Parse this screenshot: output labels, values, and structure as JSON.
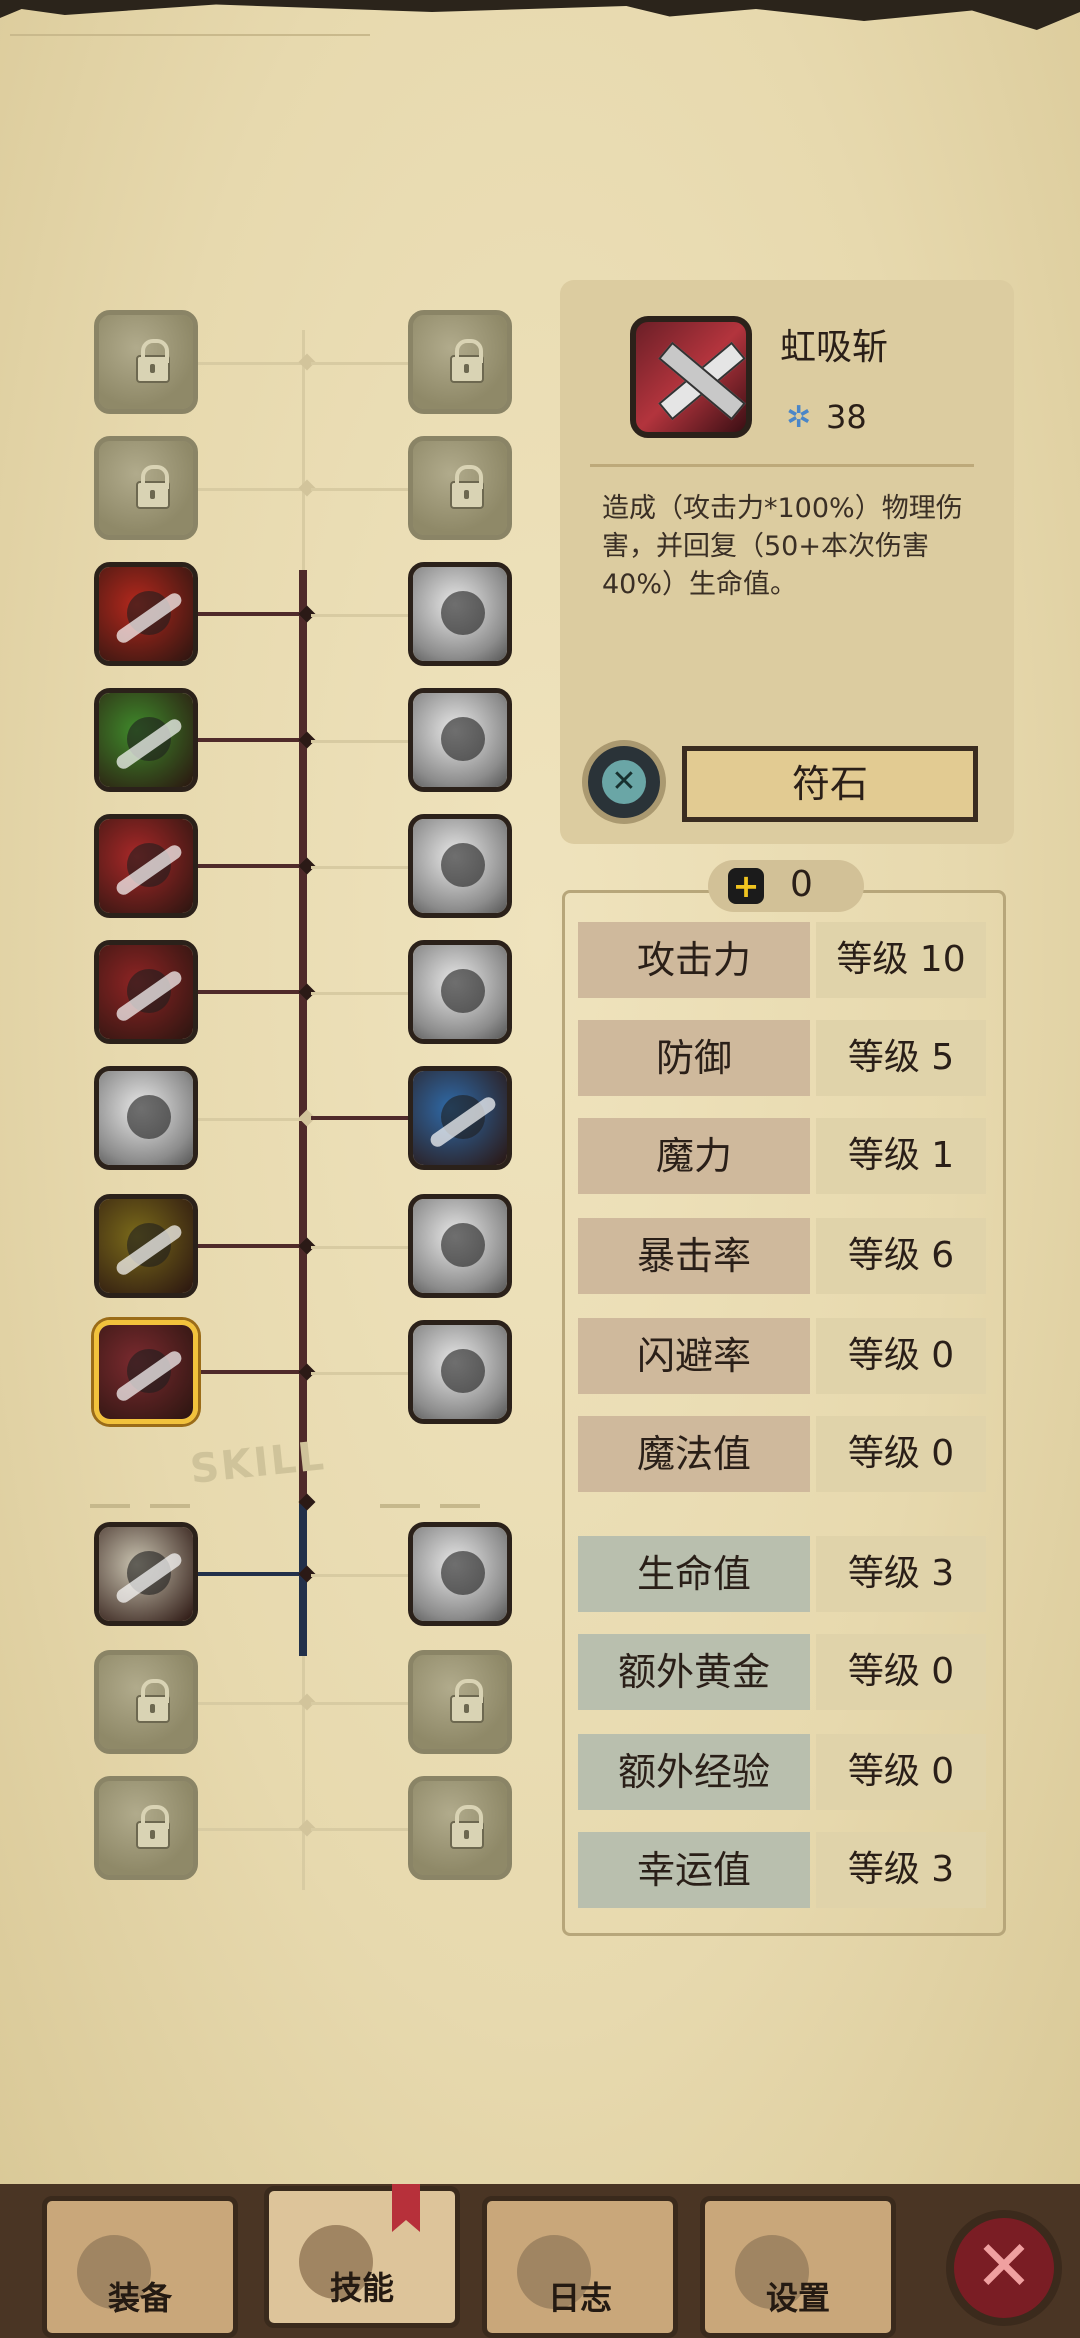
{
  "skill_tree": {
    "divider_label": "SKILL",
    "left_column": [
      {
        "state": "locked",
        "icon": "lock-icon"
      },
      {
        "state": "locked",
        "icon": "lock-icon"
      },
      {
        "state": "learned",
        "icon": "rage-face-icon",
        "color": "#b4281d"
      },
      {
        "state": "learned",
        "icon": "flex-arm-icon",
        "color": "#3f8a2b"
      },
      {
        "state": "learned",
        "icon": "shadow-slash-icon",
        "color": "#a82828"
      },
      {
        "state": "learned",
        "icon": "dagger-icon",
        "color": "#8e2424"
      },
      {
        "state": "unlearned",
        "icon": "falling-figure-icon"
      },
      {
        "state": "learned",
        "icon": "lightning-warrior-icon",
        "color": "#7a6a1a"
      },
      {
        "state": "selected",
        "icon": "crossed-swords-icon",
        "color": "#7b2a2f"
      },
      {
        "state": "learned",
        "icon": "shield-arrow-icon",
        "color": "#c9c3b0"
      },
      {
        "state": "locked",
        "icon": "lock-icon"
      },
      {
        "state": "locked",
        "icon": "lock-icon"
      }
    ],
    "right_column": [
      {
        "state": "locked",
        "icon": "lock-icon"
      },
      {
        "state": "locked",
        "icon": "lock-icon"
      },
      {
        "state": "unlearned",
        "icon": "lightning-strike-icon"
      },
      {
        "state": "unlearned",
        "icon": "dash-figure-icon"
      },
      {
        "state": "unlearned",
        "icon": "smoke-figure-icon"
      },
      {
        "state": "unlearned",
        "icon": "rock-icon"
      },
      {
        "state": "learned",
        "icon": "wind-blade-icon",
        "color": "#2f6aa8"
      },
      {
        "state": "unlearned",
        "icon": "explosion-icon"
      },
      {
        "state": "unlearned",
        "icon": "sparkle-figure-icon"
      },
      {
        "state": "unlearned",
        "icon": "eye-icon"
      },
      {
        "state": "locked",
        "icon": "lock-icon"
      },
      {
        "state": "locked",
        "icon": "lock-icon"
      }
    ]
  },
  "detail": {
    "skill_name": "虹吸斩",
    "cost": "38",
    "description": "造成（攻击力*100%）物理伤害，并回复（50+本次伤害40%）生命值。",
    "rune_button": "符石"
  },
  "stats": {
    "points": "0",
    "rows": [
      {
        "name": "攻击力",
        "level": "等级 10",
        "tone": "warm"
      },
      {
        "name": "防御",
        "level": "等级 5",
        "tone": "warm"
      },
      {
        "name": "魔力",
        "level": "等级 1",
        "tone": "warm"
      },
      {
        "name": "暴击率",
        "level": "等级 6",
        "tone": "warm"
      },
      {
        "name": "闪避率",
        "level": "等级 0",
        "tone": "warm"
      },
      {
        "name": "魔法值",
        "level": "等级 0",
        "tone": "warm"
      },
      {
        "name": "生命值",
        "level": "等级 3",
        "tone": "cool"
      },
      {
        "name": "额外黄金",
        "level": "等级 0",
        "tone": "cool"
      },
      {
        "name": "额外经验",
        "level": "等级 0",
        "tone": "cool"
      },
      {
        "name": "幸运值",
        "level": "等级 3",
        "tone": "cool"
      }
    ]
  },
  "tabs": [
    {
      "label": "装备",
      "icon": "axe-icon"
    },
    {
      "label": "技能",
      "icon": "skill-ring-icon",
      "active": true
    },
    {
      "label": "日志",
      "icon": "journal-icon"
    },
    {
      "label": "设置",
      "icon": "gear-icon"
    }
  ],
  "close_icon": "close-icon"
}
